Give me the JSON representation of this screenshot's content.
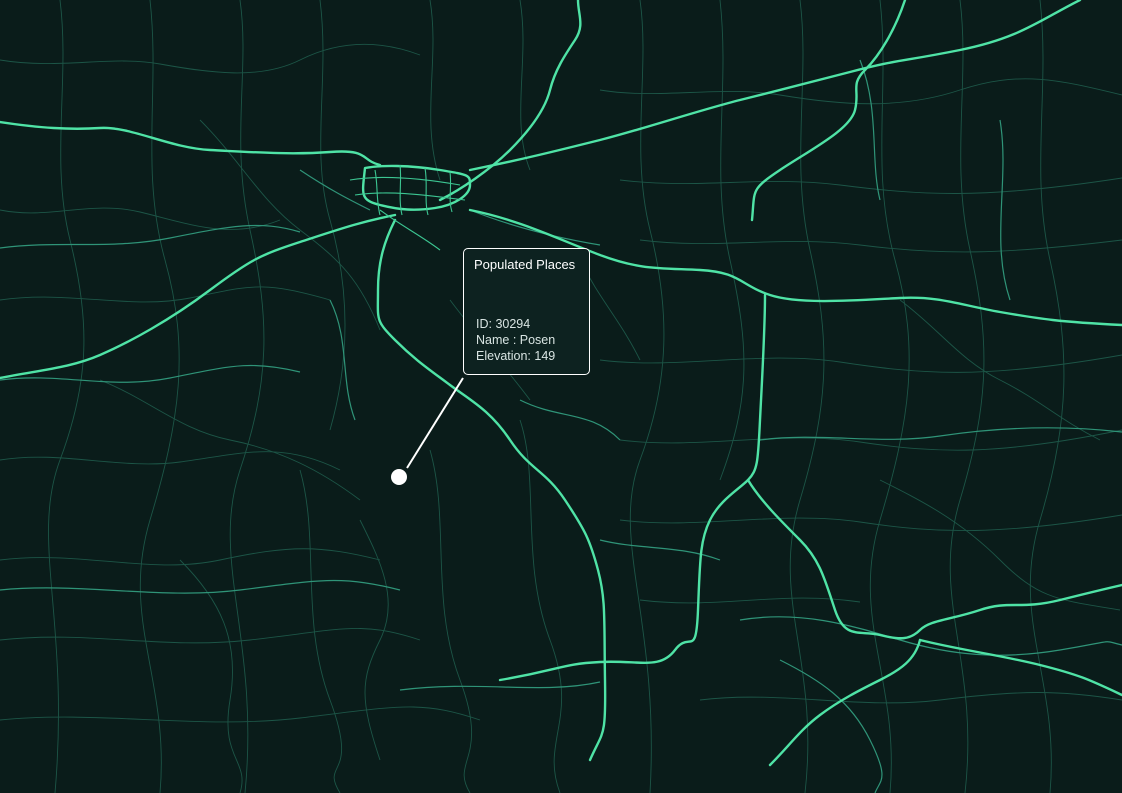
{
  "map": {
    "colors": {
      "background": "#0a1c1a",
      "highway": "#4fe3a6",
      "road": "#2f9478",
      "road_faint": "#1f5c4c",
      "marker": "#ffffff"
    }
  },
  "popup": {
    "title": "Populated Places",
    "id_text": "ID: 30294",
    "name_text": "Name : Posen",
    "elevation_text": "Elevation: 149"
  }
}
